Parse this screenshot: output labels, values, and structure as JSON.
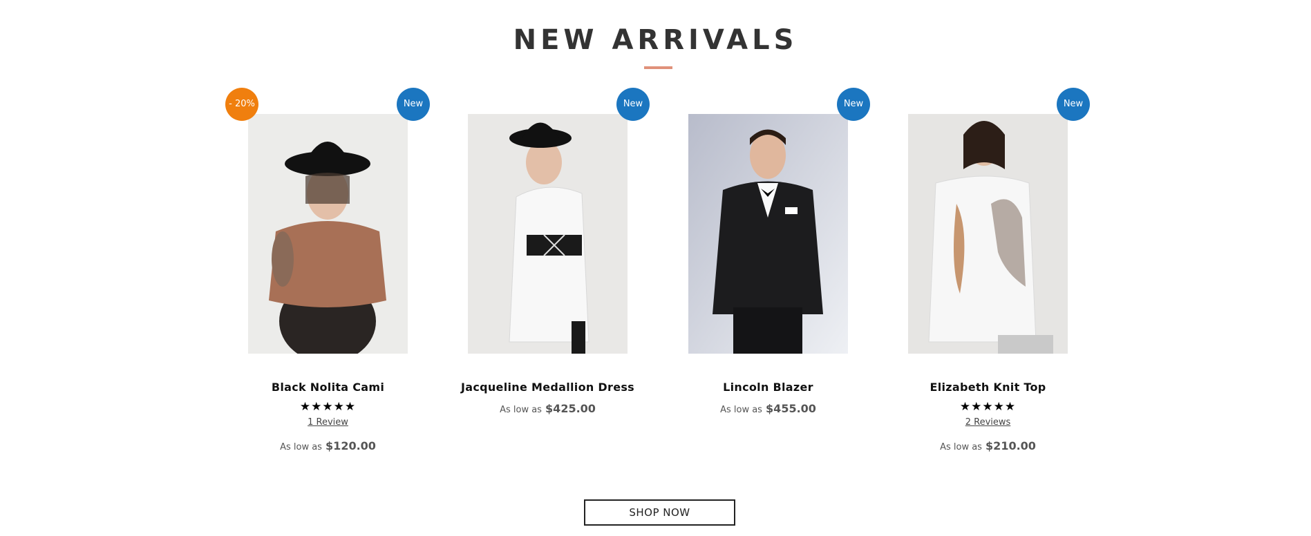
{
  "section": {
    "title": "NEW ARRIVALS"
  },
  "products": [
    {
      "name": "Black Nolita Cami",
      "badge_new": "New",
      "badge_sale": "- 20%",
      "stars": "★★★★★",
      "rating": 5,
      "reviews": "1 Review",
      "price_prefix": "As low as",
      "price": "$120.00"
    },
    {
      "name": "Jacqueline Medallion Dress",
      "badge_new": "New",
      "price_prefix": "As low as",
      "price": "$425.00"
    },
    {
      "name": "Lincoln Blazer",
      "badge_new": "New",
      "price_prefix": "As low as",
      "price": "$455.00"
    },
    {
      "name": "Elizabeth Knit Top",
      "badge_new": "New",
      "stars": "★★★★★",
      "rating": 5,
      "reviews": "2 Reviews",
      "price_prefix": "As low as",
      "price": "$210.00"
    }
  ],
  "cta": {
    "label": "SHOP NOW"
  },
  "colors": {
    "badge_new": "#1b76c0",
    "badge_sale": "#f07f0e",
    "title_underline": "#e0917a"
  }
}
